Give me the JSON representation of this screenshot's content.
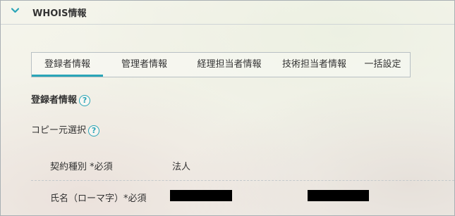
{
  "section": {
    "title": "WHOIS情報",
    "toggle_icon": "chevron-down-icon"
  },
  "tabs": [
    {
      "label": "登録者情報",
      "active": true
    },
    {
      "label": "管理者情報",
      "active": false
    },
    {
      "label": "経理担当者情報",
      "active": false
    },
    {
      "label": "技術担当者情報",
      "active": false
    },
    {
      "label": "一括設定",
      "active": false
    }
  ],
  "registrant": {
    "heading": "登録者情報",
    "help": "?",
    "copy_source_label": "コピー元選択",
    "copy_help": "?"
  },
  "fields": {
    "contract_type": {
      "label": "契約種別 *必須",
      "value": "法人"
    },
    "name_roman": {
      "label": "氏名（ローマ字）*必須",
      "values_redacted": true
    }
  },
  "colors": {
    "accent": "#2aa5b7",
    "redaction": "#000000"
  }
}
